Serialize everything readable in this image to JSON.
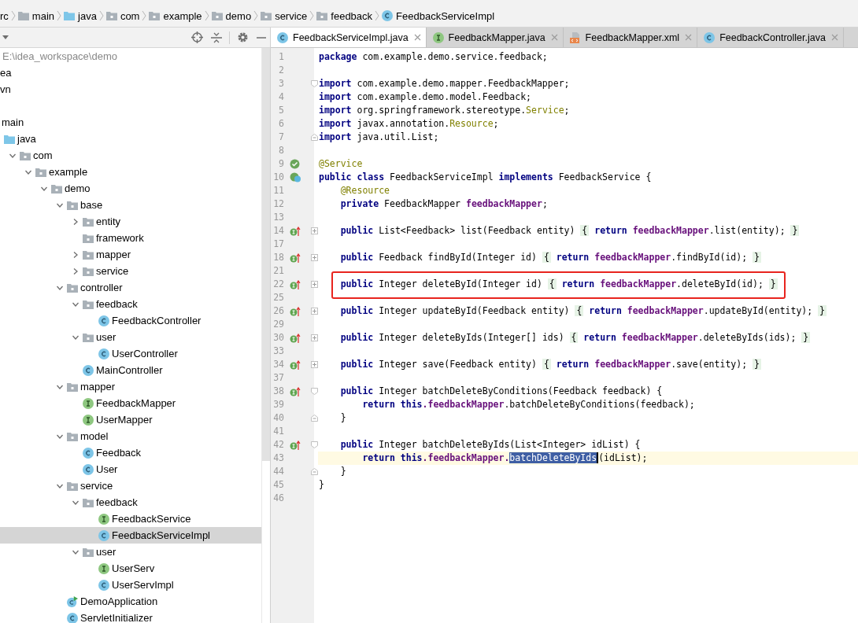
{
  "breadcrumb": [
    {
      "label": "rc"
    },
    {
      "label": "main",
      "kind": "folder"
    },
    {
      "label": "java",
      "kind": "source-folder"
    },
    {
      "label": "com",
      "kind": "package"
    },
    {
      "label": "example",
      "kind": "package"
    },
    {
      "label": "demo",
      "kind": "package"
    },
    {
      "label": "service",
      "kind": "package"
    },
    {
      "label": "feedback",
      "kind": "package"
    },
    {
      "label": "FeedbackServiceImpl",
      "kind": "class"
    }
  ],
  "project": {
    "path": "E:\\idea_workspace\\demo",
    "selected": false,
    "children": [
      {
        "label": "ea",
        "selected": false
      },
      {
        "label": "vn",
        "selected": false
      },
      {
        "selected": false,
        "children": [
          {
            "label": "main",
            "selected": false,
            "children": [
              {
                "label": "java",
                "kind": "source-folder",
                "selected": false,
                "children": [
                  {
                    "label": "com",
                    "kind": "package",
                    "expanded": true,
                    "selected": false,
                    "children": [
                      {
                        "label": "example",
                        "kind": "package",
                        "expanded": true,
                        "selected": false,
                        "children": [
                          {
                            "label": "demo",
                            "kind": "package",
                            "expanded": true,
                            "selected": false,
                            "children": [
                              {
                                "label": "base",
                                "kind": "package",
                                "expanded": true,
                                "selected": false,
                                "children": [
                                  {
                                    "label": "entity",
                                    "kind": "package",
                                    "expanded": false,
                                    "selected": false
                                  },
                                  {
                                    "label": "framework",
                                    "kind": "package",
                                    "selected": false
                                  },
                                  {
                                    "label": "mapper",
                                    "kind": "package",
                                    "expanded": false,
                                    "selected": false
                                  },
                                  {
                                    "label": "service",
                                    "kind": "package",
                                    "expanded": false,
                                    "selected": false
                                  }
                                ]
                              },
                              {
                                "label": "controller",
                                "kind": "package",
                                "expanded": true,
                                "selected": false,
                                "children": [
                                  {
                                    "label": "feedback",
                                    "kind": "package",
                                    "expanded": true,
                                    "selected": false,
                                    "children": [
                                      {
                                        "label": "FeedbackController",
                                        "kind": "class",
                                        "selected": false
                                      }
                                    ]
                                  },
                                  {
                                    "label": "user",
                                    "kind": "package",
                                    "expanded": true,
                                    "selected": false,
                                    "children": [
                                      {
                                        "label": "UserController",
                                        "kind": "class",
                                        "selected": false
                                      }
                                    ]
                                  },
                                  {
                                    "label": "MainController",
                                    "kind": "class",
                                    "selected": false
                                  }
                                ]
                              },
                              {
                                "label": "mapper",
                                "kind": "package",
                                "expanded": true,
                                "selected": false,
                                "children": [
                                  {
                                    "label": "FeedbackMapper",
                                    "kind": "interface",
                                    "selected": false
                                  },
                                  {
                                    "label": "UserMapper",
                                    "kind": "interface",
                                    "selected": false
                                  }
                                ]
                              },
                              {
                                "label": "model",
                                "kind": "package",
                                "expanded": true,
                                "selected": false,
                                "children": [
                                  {
                                    "label": "Feedback",
                                    "kind": "class",
                                    "selected": false
                                  },
                                  {
                                    "label": "User",
                                    "kind": "class",
                                    "selected": false
                                  }
                                ]
                              },
                              {
                                "label": "service",
                                "kind": "package",
                                "expanded": true,
                                "selected": false,
                                "children": [
                                  {
                                    "label": "feedback",
                                    "kind": "package",
                                    "expanded": true,
                                    "selected": false,
                                    "children": [
                                      {
                                        "label": "FeedbackService",
                                        "kind": "interface",
                                        "selected": false
                                      },
                                      {
                                        "label": "FeedbackServiceImpl",
                                        "kind": "class",
                                        "selected": true
                                      }
                                    ]
                                  },
                                  {
                                    "label": "user",
                                    "kind": "package",
                                    "expanded": true,
                                    "selected": false,
                                    "children": [
                                      {
                                        "label": "UserServ",
                                        "kind": "interface",
                                        "selected": false
                                      },
                                      {
                                        "label": "UserServImpl",
                                        "kind": "class",
                                        "selected": false
                                      }
                                    ]
                                  }
                                ]
                              },
                              {
                                "label": "DemoApplication",
                                "kind": "application",
                                "selected": false
                              },
                              {
                                "label": "ServletInitializer",
                                "kind": "class",
                                "selected": false
                              }
                            ]
                          }
                        ]
                      }
                    ]
                  }
                ]
              }
            ]
          }
        ]
      }
    ]
  },
  "tabs": [
    {
      "label": "FeedbackServiceImpl.java",
      "kind": "class",
      "selected": true
    },
    {
      "label": "FeedbackMapper.java",
      "kind": "interface",
      "selected": false
    },
    {
      "label": "FeedbackMapper.xml",
      "kind": "xml",
      "selected": false
    },
    {
      "label": "FeedbackController.java",
      "kind": "class",
      "selected": false
    }
  ],
  "editor": {
    "lines": [
      {
        "number": "1",
        "tokens": [
          {
            "kind": "keyword",
            "text": "package"
          },
          {
            "kind": "plain",
            "text": " com.example.demo.service.feedback;"
          }
        ]
      },
      {
        "number": "2"
      },
      {
        "number": "3",
        "fold": {
          "kind": "open"
        },
        "tokens": [
          {
            "kind": "keyword",
            "text": "import"
          },
          {
            "kind": "plain",
            "text": " com.example.demo.mapper.FeedbackMapper;"
          }
        ]
      },
      {
        "number": "4",
        "tokens": [
          {
            "kind": "keyword",
            "text": "import"
          },
          {
            "kind": "plain",
            "text": " com.example.demo.model.Feedback;"
          }
        ]
      },
      {
        "number": "5",
        "tokens": [
          {
            "kind": "keyword",
            "text": "import"
          },
          {
            "kind": "plain",
            "text": " org.springframework.stereotype."
          },
          {
            "kind": "annotation",
            "text": "Service"
          },
          {
            "kind": "plain",
            "text": ";"
          }
        ]
      },
      {
        "number": "6",
        "tokens": [
          {
            "kind": "keyword",
            "text": "import"
          },
          {
            "kind": "plain",
            "text": " javax.annotation."
          },
          {
            "kind": "annotation",
            "text": "Resource"
          },
          {
            "kind": "plain",
            "text": ";"
          }
        ]
      },
      {
        "number": "7",
        "fold": {
          "kind": "close"
        },
        "tokens": [
          {
            "kind": "keyword",
            "text": "import"
          },
          {
            "kind": "plain",
            "text": " java.util.List;"
          }
        ]
      },
      {
        "number": "8"
      },
      {
        "number": "9",
        "gutter": {
          "kind": "bean"
        },
        "tokens": [
          {
            "kind": "annotation",
            "text": "@Service"
          }
        ]
      },
      {
        "number": "10",
        "gutter": {
          "kind": "bean-class"
        },
        "tokens": [
          {
            "kind": "keyword",
            "text": "public class"
          },
          {
            "kind": "plain",
            "text": " FeedbackServiceImpl "
          },
          {
            "kind": "keyword",
            "text": "implements"
          },
          {
            "kind": "plain",
            "text": " FeedbackService {"
          }
        ]
      },
      {
        "number": "11",
        "tokens": [
          {
            "kind": "annotation",
            "text": "    @Resource"
          }
        ]
      },
      {
        "number": "12",
        "tokens": [
          {
            "kind": "keyword",
            "text": "    private"
          },
          {
            "kind": "plain",
            "text": " FeedbackMapper "
          },
          {
            "kind": "field",
            "text": "feedbackMapper"
          },
          {
            "kind": "plain",
            "text": ";"
          }
        ]
      },
      {
        "number": "13"
      },
      {
        "number": "14",
        "gutter": {
          "kind": "implements"
        },
        "fold": {
          "kind": "collapsed"
        },
        "tokens": [
          {
            "kind": "keyword",
            "text": "    public"
          },
          {
            "kind": "plain",
            "text": " List<Feedback> list(Feedback entity) "
          },
          {
            "kind": "fold",
            "text": "{"
          },
          {
            "kind": "keyword",
            "text": " return "
          },
          {
            "kind": "field",
            "text": "feedbackMapper"
          },
          {
            "kind": "plain",
            "text": ".list(entity); "
          },
          {
            "kind": "fold",
            "text": "}"
          }
        ]
      },
      {
        "number": "17"
      },
      {
        "number": "18",
        "gutter": {
          "kind": "implements"
        },
        "fold": {
          "kind": "collapsed"
        },
        "tokens": [
          {
            "kind": "keyword",
            "text": "    public"
          },
          {
            "kind": "plain",
            "text": " Feedback findById(Integer id) "
          },
          {
            "kind": "fold",
            "text": "{"
          },
          {
            "kind": "keyword",
            "text": " return "
          },
          {
            "kind": "field",
            "text": "feedbackMapper"
          },
          {
            "kind": "plain",
            "text": ".findById(id); "
          },
          {
            "kind": "fold",
            "text": "}"
          }
        ]
      },
      {
        "number": "21"
      },
      {
        "number": "22",
        "gutter": {
          "kind": "implements"
        },
        "fold": {
          "kind": "collapsed"
        },
        "boxed": true,
        "tokens": [
          {
            "kind": "keyword",
            "text": "    public"
          },
          {
            "kind": "plain",
            "text": " Integer deleteById(Integer id) "
          },
          {
            "kind": "fold",
            "text": "{"
          },
          {
            "kind": "keyword",
            "text": " return "
          },
          {
            "kind": "field",
            "text": "feedbackMapper"
          },
          {
            "kind": "plain",
            "text": ".deleteById(id); "
          },
          {
            "kind": "fold",
            "text": "}"
          }
        ]
      },
      {
        "number": "25"
      },
      {
        "number": "26",
        "gutter": {
          "kind": "implements"
        },
        "fold": {
          "kind": "collapsed"
        },
        "tokens": [
          {
            "kind": "keyword",
            "text": "    public"
          },
          {
            "kind": "plain",
            "text": " Integer updateById(Feedback entity) "
          },
          {
            "kind": "fold",
            "text": "{"
          },
          {
            "kind": "keyword",
            "text": " return "
          },
          {
            "kind": "field",
            "text": "feedbackMapper"
          },
          {
            "kind": "plain",
            "text": ".updateById(entity); "
          },
          {
            "kind": "fold",
            "text": "}"
          }
        ]
      },
      {
        "number": "29"
      },
      {
        "number": "30",
        "gutter": {
          "kind": "implements"
        },
        "fold": {
          "kind": "collapsed"
        },
        "tokens": [
          {
            "kind": "keyword",
            "text": "    public"
          },
          {
            "kind": "plain",
            "text": " Integer deleteByIds(Integer[] ids) "
          },
          {
            "kind": "fold",
            "text": "{"
          },
          {
            "kind": "keyword",
            "text": " return "
          },
          {
            "kind": "field",
            "text": "feedbackMapper"
          },
          {
            "kind": "plain",
            "text": ".deleteByIds(ids); "
          },
          {
            "kind": "fold",
            "text": "}"
          }
        ]
      },
      {
        "number": "33"
      },
      {
        "number": "34",
        "gutter": {
          "kind": "implements"
        },
        "fold": {
          "kind": "collapsed"
        },
        "tokens": [
          {
            "kind": "keyword",
            "text": "    public"
          },
          {
            "kind": "plain",
            "text": " Integer save(Feedback entity) "
          },
          {
            "kind": "fold",
            "text": "{"
          },
          {
            "kind": "keyword",
            "text": " return "
          },
          {
            "kind": "field",
            "text": "feedbackMapper"
          },
          {
            "kind": "plain",
            "text": ".save(entity); "
          },
          {
            "kind": "fold",
            "text": "}"
          }
        ]
      },
      {
        "number": "37"
      },
      {
        "number": "38",
        "gutter": {
          "kind": "implements"
        },
        "fold": {
          "kind": "open"
        },
        "tokens": [
          {
            "kind": "keyword",
            "text": "    public"
          },
          {
            "kind": "plain",
            "text": " Integer batchDeleteByConditions(Feedback feedback) {"
          }
        ]
      },
      {
        "number": "39",
        "tokens": [
          {
            "kind": "keyword",
            "text": "        return this"
          },
          {
            "kind": "field",
            "text": ".feedbackMapper"
          },
          {
            "kind": "plain",
            "text": ".batchDeleteByConditions(feedback);"
          }
        ]
      },
      {
        "number": "40",
        "fold": {
          "kind": "close"
        },
        "tokens": [
          {
            "kind": "plain",
            "text": "    }"
          }
        ]
      },
      {
        "number": "41"
      },
      {
        "number": "42",
        "gutter": {
          "kind": "implements"
        },
        "fold": {
          "kind": "open"
        },
        "tokens": [
          {
            "kind": "keyword",
            "text": "    public"
          },
          {
            "kind": "plain",
            "text": " Integer batchDeleteByIds(List<Integer> idList) {"
          }
        ]
      },
      {
        "number": "43",
        "current": true,
        "tokens": [
          {
            "kind": "keyword",
            "text": "        return this"
          },
          {
            "kind": "field",
            "text": ".feedbackMapper."
          },
          {
            "kind": "selection",
            "text": "batchDeleteByIds"
          },
          {
            "kind": "plain",
            "text": "(idList);"
          }
        ]
      },
      {
        "number": "44",
        "fold": {
          "kind": "close"
        },
        "tokens": [
          {
            "kind": "plain",
            "text": "    }"
          }
        ]
      },
      {
        "number": "45",
        "tokens": [
          {
            "kind": "plain",
            "text": "}"
          }
        ]
      },
      {
        "number": "46"
      }
    ]
  }
}
